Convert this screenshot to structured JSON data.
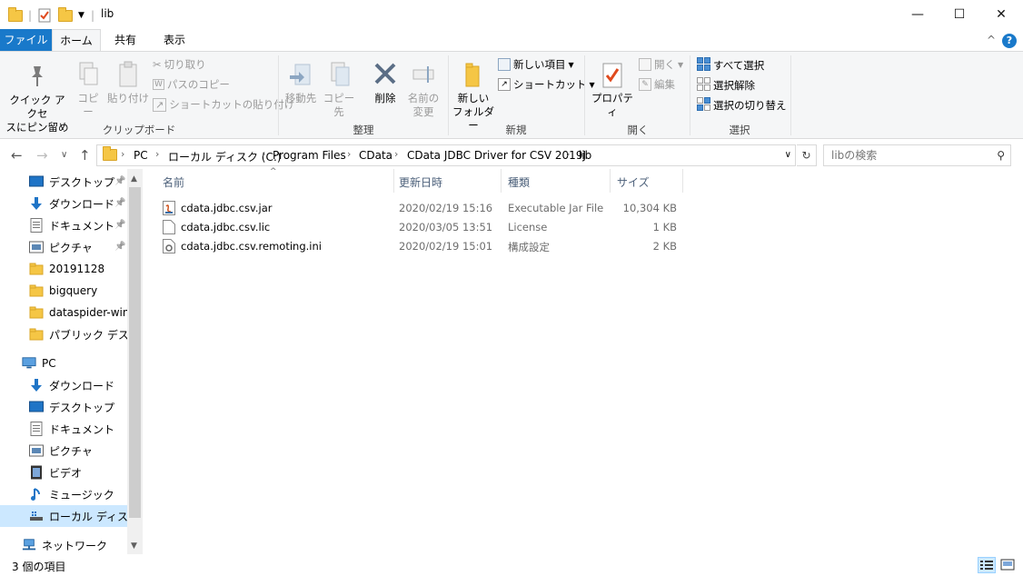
{
  "window": {
    "title": "lib",
    "minimize": "—",
    "maximize": "☐",
    "close": "✕"
  },
  "ribbon_tabs": [
    "ファイル",
    "ホーム",
    "共有",
    "表示"
  ],
  "ribbon": {
    "clipboard": {
      "pin_quick": "クイック アクセス\nにピン留め",
      "pin_quick_line1": "クイック アクセ",
      "pin_quick_line2": "スにピン留め",
      "copy": "コピー",
      "paste": "貼り付け",
      "cut": "切り取り",
      "copy_path": "パスのコピー",
      "paste_shortcut": "ショートカットの貼り付け",
      "label": "クリップボード"
    },
    "organize": {
      "move_to": "移動先",
      "copy_to": "コピー先",
      "delete": "削除",
      "rename_line1": "名前の",
      "rename_line2": "変更",
      "label": "整理"
    },
    "new": {
      "new_folder_line1": "新しい",
      "new_folder_line2": "フォルダー",
      "new_item": "新しい項目",
      "shortcut": "ショートカット",
      "label": "新規"
    },
    "open": {
      "properties": "プロパティ",
      "open": "開く",
      "edit": "編集",
      "label": "開く"
    },
    "select": {
      "select_all": "すべて選択",
      "select_none": "選択解除",
      "invert": "選択の切り替え",
      "label": "選択"
    }
  },
  "address": {
    "crumbs": [
      "PC",
      "ローカル ディスク (C:)",
      "Program Files",
      "CData",
      "CData JDBC Driver for CSV 2019J",
      "lib"
    ],
    "search_placeholder": "libの検索"
  },
  "nav_pane": {
    "quick_access": [
      {
        "label": "デスクトップ",
        "icon": "desktop-icon",
        "pinned": true
      },
      {
        "label": "ダウンロード",
        "icon": "download-icon",
        "pinned": true
      },
      {
        "label": "ドキュメント",
        "icon": "document-icon",
        "pinned": true
      },
      {
        "label": "ピクチャ",
        "icon": "picture-icon",
        "pinned": true
      },
      {
        "label": "20191128",
        "icon": "folder-icon",
        "pinned": false
      },
      {
        "label": "bigquery",
        "icon": "folder-icon",
        "pinned": false
      },
      {
        "label": "dataspider-wind",
        "icon": "folder-icon",
        "pinned": false
      },
      {
        "label": "パブリック デスクトッ",
        "icon": "folder-icon",
        "pinned": false
      }
    ],
    "pc_label": "PC",
    "pc_items": [
      {
        "label": "ダウンロード",
        "icon": "download-icon"
      },
      {
        "label": "デスクトップ",
        "icon": "desktop-icon"
      },
      {
        "label": "ドキュメント",
        "icon": "document-icon"
      },
      {
        "label": "ピクチャ",
        "icon": "picture-icon"
      },
      {
        "label": "ビデオ",
        "icon": "video-icon"
      },
      {
        "label": "ミュージック",
        "icon": "music-icon"
      },
      {
        "label": "ローカル ディスク (C",
        "icon": "drive-icon"
      }
    ],
    "network_label": "ネットワーク"
  },
  "columns": [
    "名前",
    "更新日時",
    "種類",
    "サイズ"
  ],
  "files": [
    {
      "name": "cdata.jdbc.csv.jar",
      "modified": "2020/02/19 15:16",
      "type": "Executable Jar File",
      "size": "10,304 KB",
      "icon": "jar-file-icon"
    },
    {
      "name": "cdata.jdbc.csv.lic",
      "modified": "2020/03/05 13:51",
      "type": "License",
      "size": "1 KB",
      "icon": "blank-file-icon"
    },
    {
      "name": "cdata.jdbc.csv.remoting.ini",
      "modified": "2020/02/19 15:01",
      "type": "構成設定",
      "size": "2 KB",
      "icon": "config-file-icon"
    }
  ],
  "status": {
    "item_count": "3 個の項目"
  },
  "colors": {
    "accent": "#1979ca",
    "selection": "#cce8ff"
  }
}
